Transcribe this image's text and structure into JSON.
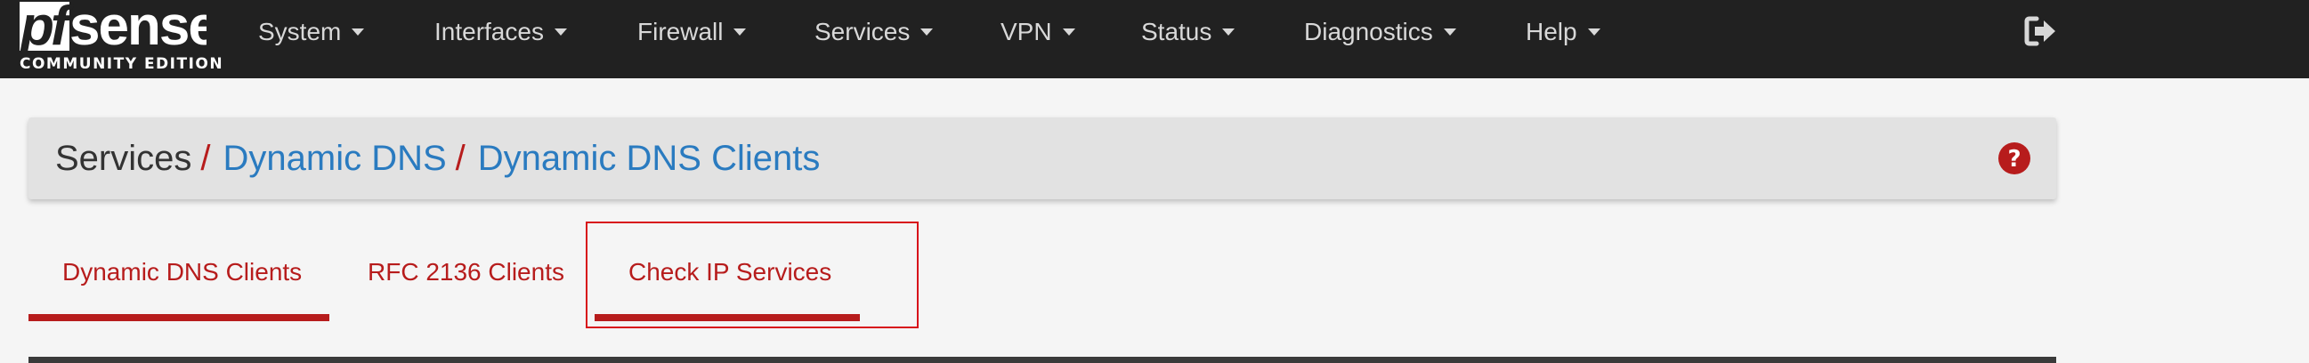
{
  "brand": {
    "logo_text": "pfsense",
    "edition": "COMMUNITY EDITION"
  },
  "nav": {
    "items": [
      {
        "label": "System"
      },
      {
        "label": "Interfaces"
      },
      {
        "label": "Firewall"
      },
      {
        "label": "Services"
      },
      {
        "label": "VPN"
      },
      {
        "label": "Status"
      },
      {
        "label": "Diagnostics"
      },
      {
        "label": "Help"
      }
    ],
    "logout_icon": "sign-out-icon"
  },
  "breadcrumb": {
    "root": "Services",
    "separator": "/",
    "level1": "Dynamic DNS",
    "level2": "Dynamic DNS Clients",
    "help_icon": "question-circle-icon"
  },
  "tabs": [
    {
      "label": "Dynamic DNS Clients",
      "active": true
    },
    {
      "label": "RFC 2136 Clients",
      "active": false
    },
    {
      "label": "Check IP Services",
      "active": true,
      "highlighted": true
    }
  ],
  "colors": {
    "navbar_bg": "#212121",
    "accent_red": "#b71c1c",
    "link_blue": "#2a7bc0",
    "page_bg": "#f5f5f5"
  }
}
